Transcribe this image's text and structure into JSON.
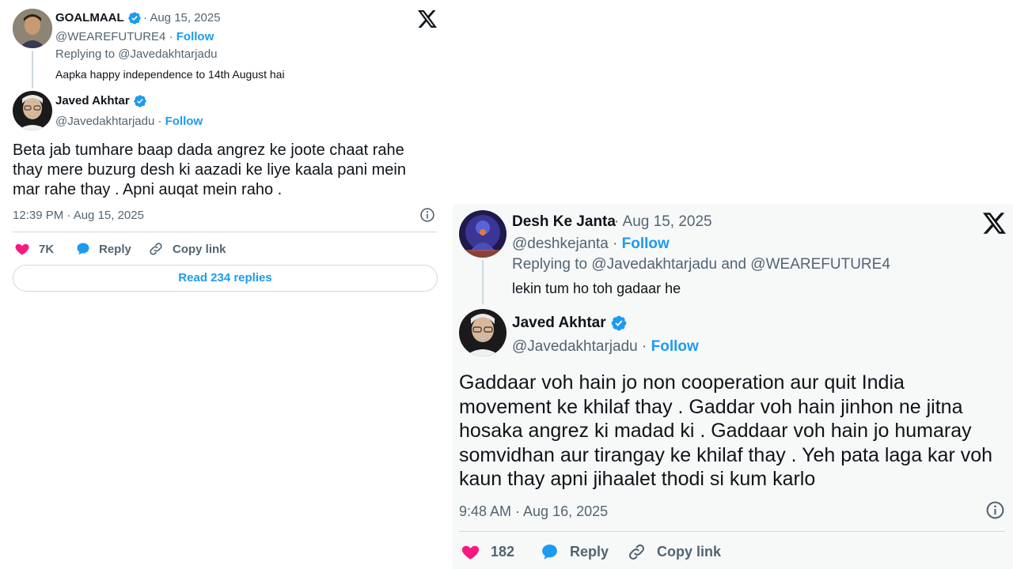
{
  "tweet_cards": [
    {
      "parent": {
        "display_name": "GOALMAAL",
        "date": "· Aug 15, 2025",
        "handle": "@WEAREFUTURE4 ·",
        "follow_label": "Follow",
        "replying_to": "Replying to @Javedakhtarjadu",
        "text": "Aapka happy independence to 14th August hai"
      },
      "main": {
        "display_name": "Javed Akhtar",
        "handle": "@Javedakhtarjadu ·",
        "follow_label": "Follow",
        "text": "Beta jab tumhare baap dada angrez ke joote chaat rahe thay mere buzurg desh ki aazadi ke liye kaala pani mein mar rahe thay . Apni auqat mein raho .",
        "timestamp": "12:39 PM · Aug 15, 2025"
      },
      "actions": {
        "likes": "7K",
        "reply_label": "Reply",
        "copy_link_label": "Copy link"
      },
      "read_replies_label": "Read 234 replies"
    },
    {
      "parent": {
        "display_name": "Desh Ke Janta",
        "date": "· Aug 15, 2025",
        "handle": "@deshkejanta ·",
        "follow_label": "Follow",
        "replying_to": "Replying to @Javedakhtarjadu and @WEAREFUTURE4",
        "text": "lekin tum ho toh gadaar he"
      },
      "main": {
        "display_name": "Javed Akhtar",
        "handle": "@Javedakhtarjadu ·",
        "follow_label": "Follow",
        "text": "Gaddaar voh hain jo non cooperation aur quit India movement ke khilaf thay . Gaddar voh hain jinhon ne jitna hosaka angrez ki madad ki . Gaddaar voh hain jo humaray somvidhan aur tirangay ke khilaf thay . Yeh pata laga kar voh kaun thay apni jihaalet thodi si kum karlo",
        "timestamp": "9:48 AM · Aug 16, 2025"
      },
      "actions": {
        "likes": "182",
        "reply_label": "Reply",
        "copy_link_label": "Copy link"
      }
    }
  ],
  "icons": {
    "x_logo": "x-logo-icon",
    "verified": "verified-badge-icon",
    "info": "info-icon",
    "like": "heart-icon",
    "reply": "reply-bubble-icon",
    "copy_link": "link-icon"
  },
  "colors": {
    "accent": "#1d9bf0",
    "like": "#f91880",
    "secondary_text": "#536471",
    "primary_text": "#0f1419"
  }
}
